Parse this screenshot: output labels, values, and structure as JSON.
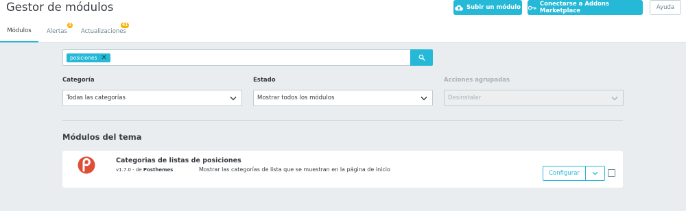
{
  "header": {
    "title": "Gestor de módulos",
    "upload_label": "Subir un módulo",
    "connect_label": "Conectarse a Addons Marketplace",
    "help_label": "Ayuda"
  },
  "tabs": [
    {
      "label": "Módulos",
      "active": true
    },
    {
      "label": "Alertas",
      "badge": "2"
    },
    {
      "label": "Actualizaciones",
      "badge": "41"
    }
  ],
  "search": {
    "tag": "posiciones",
    "input_value": ""
  },
  "filters": {
    "category": {
      "label": "Categoría",
      "value": "Todas las categorías"
    },
    "status": {
      "label": "Estado",
      "value": "Mostrar todos los módulos"
    },
    "bulk": {
      "label": "Acciones agrupadas",
      "value": "Desinstalar"
    }
  },
  "section": {
    "title": "Módulos del tema"
  },
  "module": {
    "name": "Categorias de listas de posiciones",
    "version": "v1.7.0 - de",
    "author": "Posthemes",
    "description": "Mostrar las categorías de lista que se muestran en la página de inicio",
    "configure_label": "Configurar"
  },
  "colors": {
    "accent": "#25b9d7",
    "badge": "#fab000",
    "background": "#eaedf0",
    "logo": "#df4f37"
  },
  "icons": [
    "cloud-upload-icon",
    "key-icon",
    "search-icon",
    "chevron-down-icon",
    "remove-tag-icon",
    "module-logo"
  ]
}
